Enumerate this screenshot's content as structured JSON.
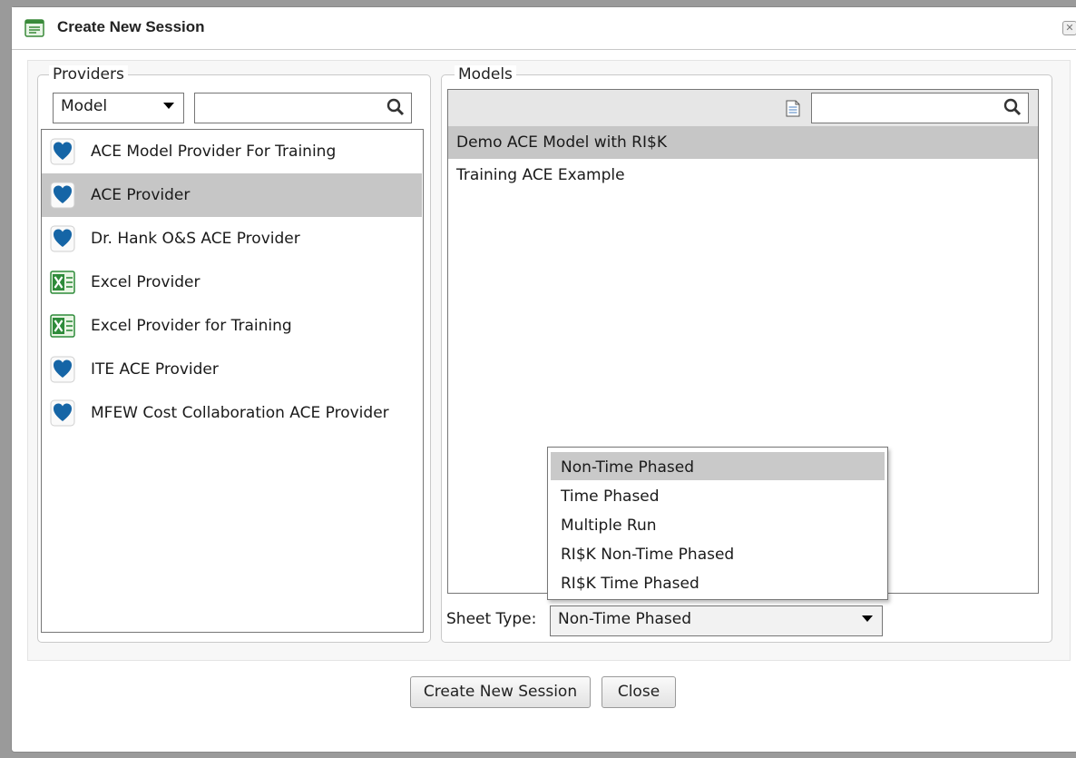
{
  "window": {
    "title": "Create New Session",
    "close_glyph": "✕"
  },
  "providers": {
    "legend": "Providers",
    "filter_select": "Model",
    "search_value": "",
    "items": [
      {
        "label": "ACE Model Provider For Training",
        "icon": "heart-icon",
        "selected": false
      },
      {
        "label": "ACE Provider",
        "icon": "heart-icon",
        "selected": true
      },
      {
        "label": "Dr. Hank O&S ACE Provider",
        "icon": "heart-icon",
        "selected": false
      },
      {
        "label": "Excel Provider",
        "icon": "excel-icon",
        "selected": false
      },
      {
        "label": "Excel Provider for Training",
        "icon": "excel-icon",
        "selected": false
      },
      {
        "label": "ITE ACE Provider",
        "icon": "heart-icon",
        "selected": false
      },
      {
        "label": "MFEW Cost Collaboration ACE Provider",
        "icon": "heart-icon",
        "selected": false
      }
    ]
  },
  "models": {
    "legend": "Models",
    "search_value": "",
    "items": [
      {
        "label": "Demo ACE Model with RI$K",
        "selected": true
      },
      {
        "label": "Training ACE Example",
        "selected": false
      }
    ]
  },
  "sheet_type": {
    "label": "Sheet Type:",
    "value": "Non-Time Phased",
    "options": [
      "Non-Time Phased",
      "Time Phased",
      "Multiple Run",
      "RI$K Non-Time Phased",
      "RI$K Time Phased"
    ]
  },
  "buttons": {
    "create": "Create New Session",
    "close": "Close"
  },
  "colors": {
    "heart": "#1565a6",
    "excel_green": "#2e8b3a",
    "selection": "#c6c6c6"
  }
}
